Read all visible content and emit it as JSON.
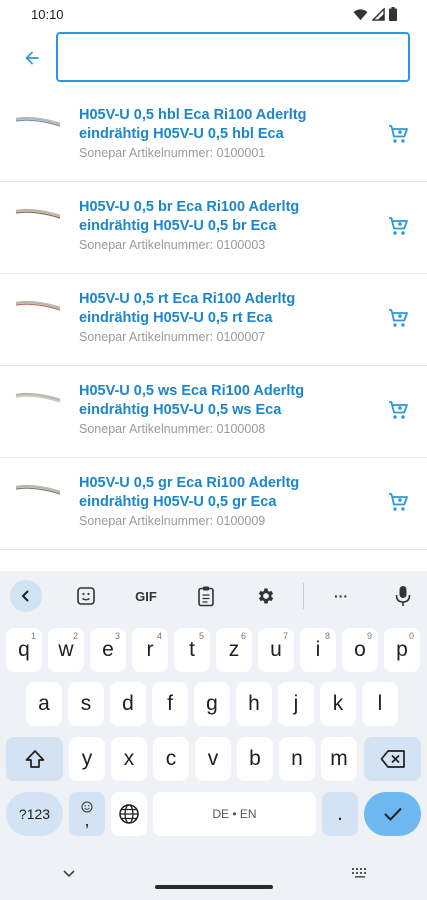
{
  "status_bar": {
    "time": "10:10",
    "icons": [
      "wifi-icon",
      "signal-icon",
      "battery-icon"
    ]
  },
  "app_bar": {
    "back_icon": "arrow-back-icon",
    "search": {
      "value": "",
      "placeholder": ""
    }
  },
  "results": [
    {
      "title": "H05V-U 0,5 hbl Eca Ri100 Aderltg eindrähtig H05V-U 0,5 hbl Eca",
      "subtitle": "Sonepar Artikelnummer: 0100001"
    },
    {
      "title": "H05V-U 0,5 br Eca Ri100 Aderltg eindrähtig H05V-U 0,5 br Eca",
      "subtitle": "Sonepar Artikelnummer: 0100003"
    },
    {
      "title": "H05V-U 0,5 rt Eca Ri100 Aderltg eindrähtig H05V-U 0,5 rt Eca",
      "subtitle": "Sonepar Artikelnummer: 0100007"
    },
    {
      "title": "H05V-U 0,5 ws Eca Ri100 Aderltg eindrähtig H05V-U 0,5 ws Eca",
      "subtitle": "Sonepar Artikelnummer: 0100008"
    },
    {
      "title": "H05V-U 0,5 gr Eca Ri100 Aderltg eindrähtig H05V-U 0,5 gr Eca",
      "subtitle": "Sonepar Artikelnummer: 0100009"
    }
  ],
  "keyboard": {
    "toolbar": {
      "gif_label": "GIF",
      "more_label": "···"
    },
    "row1": [
      {
        "key": "q",
        "hint": "1"
      },
      {
        "key": "w",
        "hint": "2"
      },
      {
        "key": "e",
        "hint": "3"
      },
      {
        "key": "r",
        "hint": "4"
      },
      {
        "key": "t",
        "hint": "5"
      },
      {
        "key": "z",
        "hint": "6"
      },
      {
        "key": "u",
        "hint": "7"
      },
      {
        "key": "i",
        "hint": "8"
      },
      {
        "key": "o",
        "hint": "9"
      },
      {
        "key": "p",
        "hint": "0"
      }
    ],
    "row2": [
      "a",
      "s",
      "d",
      "f",
      "g",
      "h",
      "j",
      "k",
      "l"
    ],
    "row3": [
      "y",
      "x",
      "c",
      "v",
      "b",
      "n",
      "m"
    ],
    "symbols_label": "?123",
    "comma_label": ",",
    "space_label": "DE • EN",
    "period_label": "."
  },
  "colors": {
    "accent": "#1c86cc",
    "input_border": "#2d9ad7",
    "keyboard_bg": "#eef1f6",
    "enter_key": "#6db8ee"
  }
}
